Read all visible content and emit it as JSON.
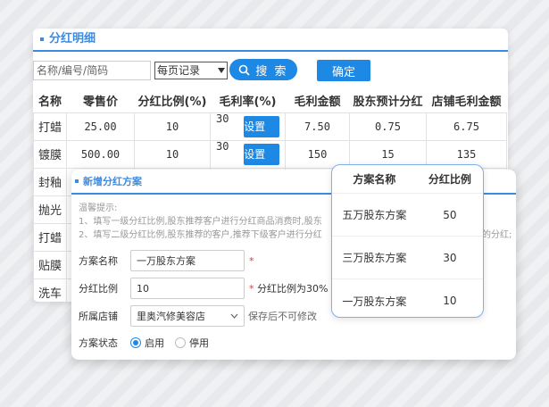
{
  "panel": {
    "title": "分红明细"
  },
  "toolbar": {
    "search_placeholder": "名称/编号/简码",
    "per_page_label": "每页记录",
    "search_label": "搜 索",
    "confirm_label": "确定"
  },
  "table": {
    "headers": [
      "名称",
      "零售价",
      "分红比例(%)",
      "毛利率(%)",
      "毛利金额",
      "股东预计分红",
      "店铺毛利金额"
    ],
    "set_label": "设置",
    "rows": [
      {
        "name": "打蜡",
        "price": "25.00",
        "ratio": "10",
        "margin": "30",
        "profit": "7.50",
        "dividend": "0.75",
        "shop": "6.75"
      },
      {
        "name": "镀膜",
        "price": "500.00",
        "ratio": "10",
        "margin": "30",
        "profit": "150",
        "dividend": "15",
        "shop": "135"
      },
      {
        "name": "封釉"
      },
      {
        "name": "抛光"
      },
      {
        "name": "打蜡"
      },
      {
        "name": "贴膜"
      },
      {
        "name": "洗车"
      }
    ]
  },
  "dialog": {
    "title": "新增分红方案",
    "tips_title": "温馨提示:",
    "tip1": "1、填写一级分红比例,股东推荐客户进行分红商品消费时,股东",
    "tip2": "2、填写二级分红比例,股东推荐的客户,推荐下级客户进行分红",
    "tip2_tail": "的分红;",
    "name_label": "方案名称",
    "name_value": "一万股东方案",
    "ratio_label": "分红比例",
    "ratio_value": "10",
    "ratio_hint": "* 分红比例为30%",
    "store_label": "所属店铺",
    "store_value": "里奥汽修美容店",
    "store_hint": "保存后不可修改",
    "status_label": "方案状态",
    "status_on": "启用",
    "status_off": "停用"
  },
  "plans": {
    "headers": [
      "方案名称",
      "分红比例"
    ],
    "rows": [
      {
        "name": "五万股东方案",
        "ratio": "50"
      },
      {
        "name": "三万股东方案",
        "ratio": "30"
      },
      {
        "name": "一万股东方案",
        "ratio": "10"
      }
    ]
  },
  "colors": {
    "accent": "#1e88e5",
    "title_blue": "#3d8be0",
    "required": "#e53935"
  }
}
